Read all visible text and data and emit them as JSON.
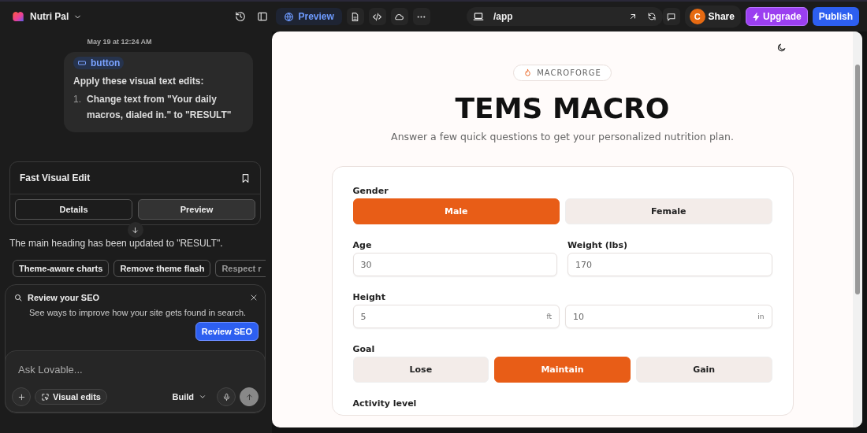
{
  "topbar": {
    "project": "Nutri Pal",
    "preview_tab": {
      "label": "Preview",
      "selected": true
    },
    "url": "/app",
    "avatar": "C",
    "share": "Share",
    "upgrade": "Upgrade",
    "publish": "Publish"
  },
  "chat": {
    "timestamp": "May 19 at 12:24 AM",
    "message": {
      "tag": "button",
      "intro": "Apply these visual text edits:",
      "items": [
        {
          "number": "1.",
          "text": "Change text from \"Your daily macros, dialed in.\" to \"RESULT\""
        }
      ]
    },
    "edit_card": {
      "title": "Fast Visual Edit",
      "buttons": [
        {
          "label": "Details",
          "selected": false
        },
        {
          "label": "Preview",
          "selected": true
        }
      ]
    },
    "reply": "The main heading has been updated to \"RESULT\".",
    "suggestions": [
      "Theme-aware charts",
      "Remove theme flash",
      "Respect r"
    ],
    "seo": {
      "title": "Review your SEO",
      "text": "See ways to improve how your site gets found in search.",
      "button": "Review SEO"
    },
    "composer": {
      "placeholder": "Ask Lovable...",
      "visual_edits": "Visual edits",
      "mode": "Build"
    }
  },
  "preview": {
    "badge": "MACROFORGE",
    "title": "TEMS MACRO",
    "subtitle": "Answer a few quick questions to get your personalized nutrition plan.",
    "form": {
      "gender": {
        "label": "Gender",
        "options": [
          {
            "label": "Male",
            "selected": true
          },
          {
            "label": "Female",
            "selected": false
          }
        ]
      },
      "age": {
        "label": "Age",
        "value": "30"
      },
      "weight": {
        "label": "Weight (lbs)",
        "value": "170"
      },
      "height": {
        "label": "Height",
        "fields": [
          {
            "value": "5",
            "unit": "ft"
          },
          {
            "value": "10",
            "unit": "in"
          }
        ]
      },
      "goal": {
        "label": "Goal",
        "options": [
          {
            "label": "Lose",
            "selected": false
          },
          {
            "label": "Maintain",
            "selected": true
          },
          {
            "label": "Gain",
            "selected": false
          }
        ]
      },
      "activity": {
        "label": "Activity level"
      }
    }
  }
}
